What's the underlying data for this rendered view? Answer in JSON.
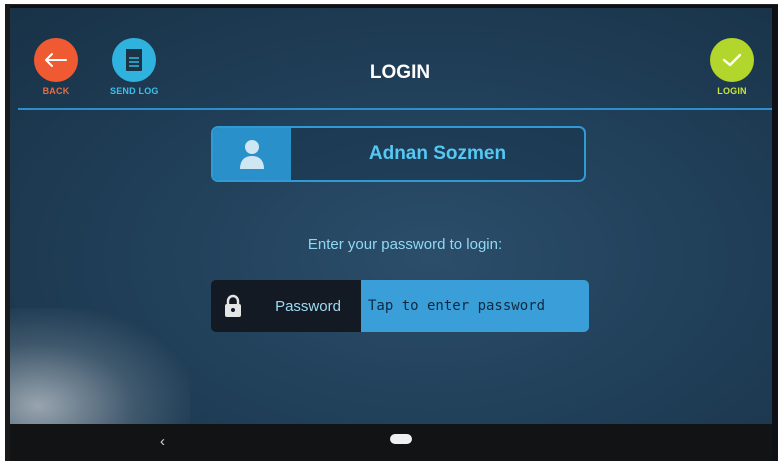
{
  "toolbar": {
    "back_label": "BACK",
    "send_log_label": "SEND LOG",
    "login_label": "LOGIN",
    "title": "LOGIN"
  },
  "user": {
    "name": "Adnan Sozmen"
  },
  "prompt": "Enter your password to login:",
  "password": {
    "label": "Password",
    "placeholder": "Tap to enter password",
    "value": ""
  },
  "colors": {
    "back": "#ef5a33",
    "send_log": "#2fb2dd",
    "login": "#b3d62c",
    "accent": "#2e8ec9"
  },
  "icons": {
    "back": "arrow-left-icon",
    "send_log": "notepad-icon",
    "login": "checkmark-icon",
    "user": "user-icon",
    "lock": "lock-icon"
  },
  "navbar": {
    "back_glyph": "‹"
  }
}
